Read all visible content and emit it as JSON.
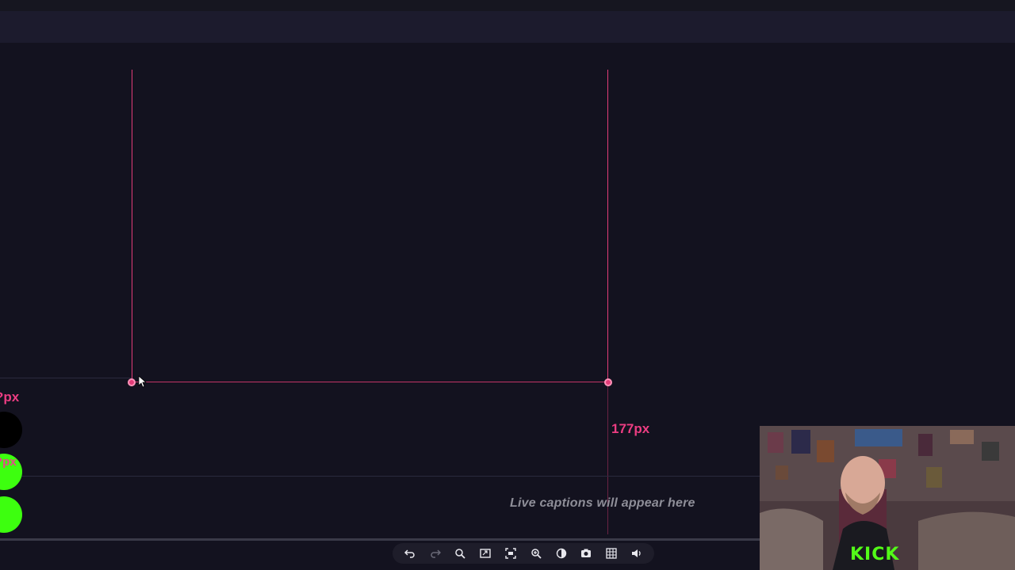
{
  "canvas": {
    "measure_right": "177px",
    "measure_left_partial": "?px",
    "swatch_label_partial": "?px",
    "captions_text": "Live captions will appear here"
  },
  "swatches": [
    {
      "name": "black",
      "color": "#000000"
    },
    {
      "name": "green-1",
      "color": "#3dff0f"
    },
    {
      "name": "green-2",
      "color": "#3dff0f"
    }
  ],
  "colors": {
    "guide": "#e23c78",
    "background": "#13121f",
    "topbar": "#1c1b2d"
  },
  "toolbar": {
    "buttons": [
      {
        "name": "undo-icon"
      },
      {
        "name": "redo-icon"
      },
      {
        "name": "zoom-out-icon"
      },
      {
        "name": "fit-frame-icon"
      },
      {
        "name": "screenshot-area-icon"
      },
      {
        "name": "zoom-in-icon"
      },
      {
        "name": "contrast-icon"
      },
      {
        "name": "camera-icon"
      },
      {
        "name": "grid-icon"
      },
      {
        "name": "volume-icon"
      }
    ]
  },
  "webcam": {
    "logo": "KICK"
  }
}
